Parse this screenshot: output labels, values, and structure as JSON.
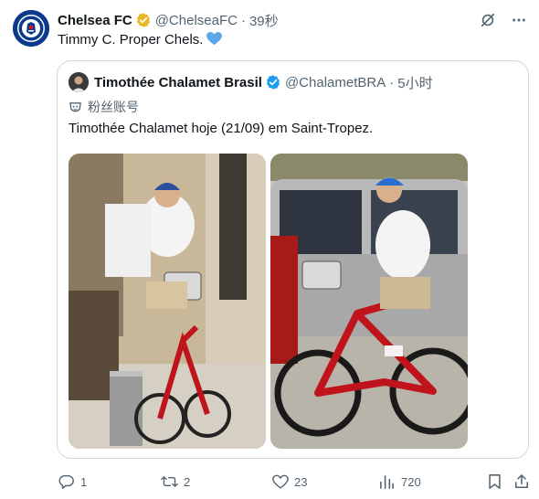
{
  "tweet": {
    "display_name": "Chelsea FC",
    "handle": "@ChelseaFC",
    "separator": "·",
    "time": "39秒",
    "text": "Timmy C. Proper Chels.",
    "avatar_icon": "chelsea-crest",
    "verified_color": "#e8b923"
  },
  "quoted": {
    "display_name": "Timothée Chalamet Brasil",
    "handle": "@ChalametBRA",
    "separator": "·",
    "time": "5小时",
    "subtitle": "粉丝账号",
    "text": "Timothée Chalamet hoje (21/09) em Saint-Tropez.",
    "verified_color": "#1d9bf0",
    "photos": [
      {
        "icon": "photo-cyclist-street"
      },
      {
        "icon": "photo-cyclist-red-bike"
      }
    ]
  },
  "actions": {
    "replies": "1",
    "retweets": "2",
    "likes": "23",
    "views": "720"
  },
  "colors": {
    "text_primary": "#0f1419",
    "text_secondary": "#536471",
    "border": "#cfd9de",
    "accent": "#1d9bf0"
  }
}
